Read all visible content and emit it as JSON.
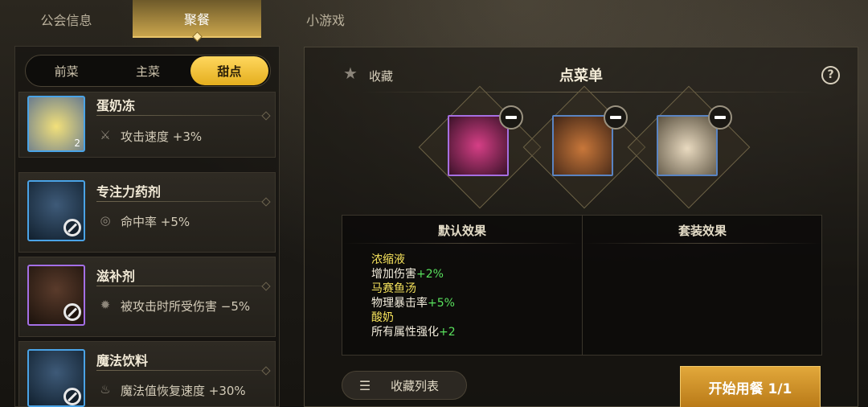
{
  "top_tabs": [
    {
      "label": "公会信息"
    },
    {
      "label": "聚餐"
    },
    {
      "label": "小游戏"
    }
  ],
  "categories": [
    {
      "label": "前菜"
    },
    {
      "label": "主菜"
    },
    {
      "label": "甜点"
    }
  ],
  "dishes": [
    {
      "name": "蛋奶冻",
      "effect": "攻击速度 +3%",
      "count": "2",
      "effect_icon": "sword-icon"
    },
    {
      "name": "专注力药剂",
      "effect": "命中率 +5%",
      "effect_icon": "target-icon"
    },
    {
      "name": "滋补剂",
      "effect": "被攻击时所受伤害 −5%",
      "effect_icon": "spiky-icon"
    },
    {
      "name": "魔法饮料",
      "effect": "魔法值恢复速度 +30%",
      "effect_icon": "potion-icon"
    }
  ],
  "menu": {
    "fav_label": "收藏",
    "title": "点菜单",
    "help": "?"
  },
  "effects": {
    "default_title": "默认效果",
    "set_title": "套装效果",
    "items": [
      {
        "name": "浓缩液",
        "stat": "增加伤害",
        "value": "+2%"
      },
      {
        "name": "马赛鱼汤",
        "stat": "物理暴击率",
        "value": "+5%"
      },
      {
        "name": "酸奶",
        "stat": "所有属性强化",
        "value": "+2"
      }
    ]
  },
  "buttons": {
    "fav_list": "收藏列表",
    "start": "开始用餐 1/1"
  },
  "colors": {
    "accent_gold": "#e4ae1e",
    "effect_name": "#f5e25c",
    "effect_value": "#59e15d"
  }
}
